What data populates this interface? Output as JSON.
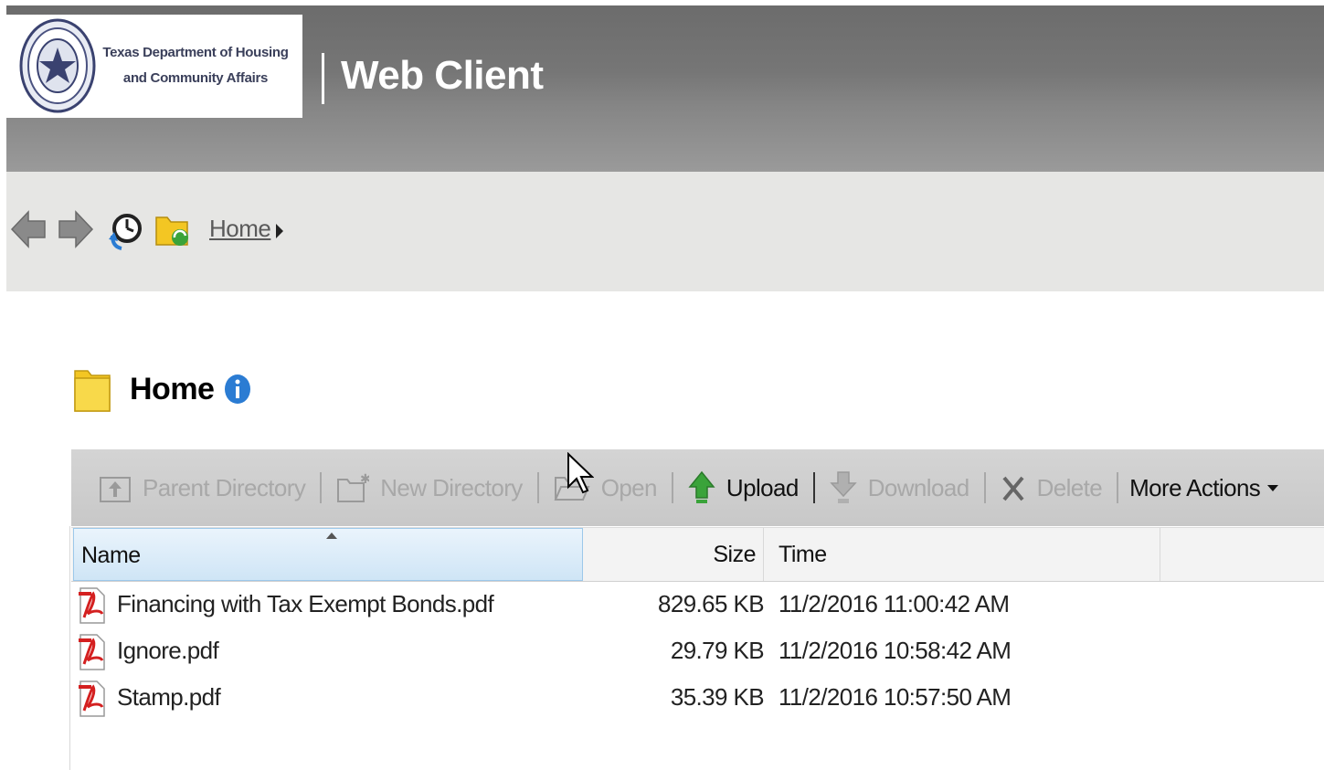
{
  "header": {
    "logo_line1": "Texas Department of Housing",
    "logo_line2": "and Community Affairs",
    "app_title": "Web Client",
    "header_color": "#777777"
  },
  "nav": {
    "back_icon": "arrow-left-icon",
    "forward_icon": "arrow-right-icon",
    "history_icon": "history-clock-icon",
    "sync_folder_icon": "folder-sync-icon",
    "breadcrumb_home": "Home"
  },
  "folder": {
    "title": "Home",
    "info_icon": "info-icon"
  },
  "toolbar": {
    "parent_directory": "Parent Directory",
    "new_directory": "New Directory",
    "open": "Open",
    "upload": "Upload",
    "download": "Download",
    "delete": "Delete",
    "more_actions": "More Actions"
  },
  "table": {
    "columns": [
      "Name",
      "Size",
      "Time"
    ],
    "rows": [
      {
        "name": "Financing with Tax Exempt Bonds.pdf",
        "size": "829.65 KB",
        "time": "11/2/2016 11:00:42 AM",
        "icon": "pdf-icon"
      },
      {
        "name": "Ignore.pdf",
        "size": "29.79 KB",
        "time": "11/2/2016 10:58:42 AM",
        "icon": "pdf-icon"
      },
      {
        "name": "Stamp.pdf",
        "size": "35.39 KB",
        "time": "11/2/2016 10:57:50 AM",
        "icon": "pdf-icon"
      }
    ]
  },
  "colors": {
    "accent_blue": "#2b7cd3",
    "upload_green": "#3aa33a",
    "pdf_red": "#d42020",
    "folder_yellow": "#f3c623"
  }
}
